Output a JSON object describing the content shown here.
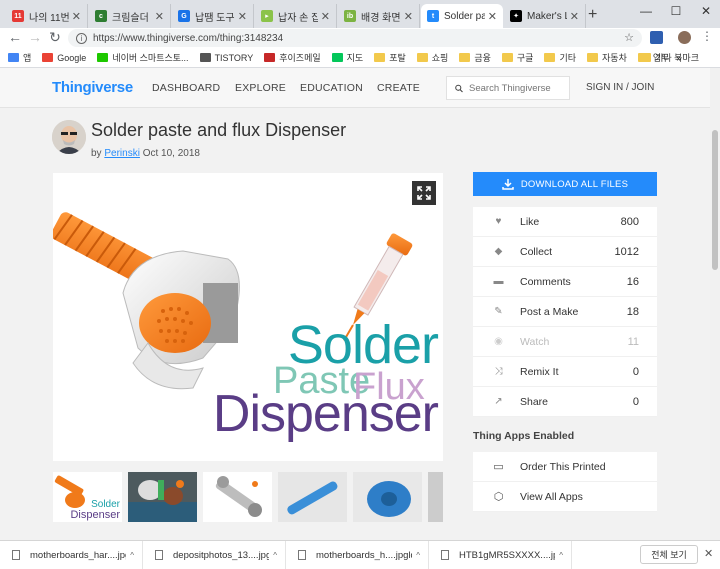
{
  "browser": {
    "tabs": [
      {
        "title": "나의 11번가",
        "color": "#e53935",
        "fav": "11"
      },
      {
        "title": "크림슬더",
        "color": "#2e7d32",
        "fav": "c"
      },
      {
        "title": "납땜 도구 -",
        "color": "#1a73e8",
        "fav": "G"
      },
      {
        "title": "납자 손 집",
        "color": "#8bc34a",
        "fav": "▸"
      },
      {
        "title": "배경 화면",
        "color": "#7cb342",
        "fav": "ib"
      },
      {
        "title": "Solder paste",
        "color": "#248bfb",
        "fav": "t"
      },
      {
        "title": "Maker's LAB",
        "color": "#000000",
        "fav": "✦"
      }
    ],
    "active_tab_index": 5,
    "new_tab": "+",
    "url": "https://www.thingiverse.com/thing:3148234",
    "bookmarks": [
      {
        "label": "앱",
        "type": "apps"
      },
      {
        "label": "Google",
        "type": "google"
      },
      {
        "label": "네이버 스마트스토...",
        "type": "naver"
      },
      {
        "label": "TISTORY",
        "type": "tistory"
      },
      {
        "label": "후이즈메일",
        "type": "whois"
      },
      {
        "label": "지도",
        "type": "map"
      },
      {
        "label": "포탈",
        "type": "folder"
      },
      {
        "label": "쇼핑",
        "type": "folder"
      },
      {
        "label": "금융",
        "type": "folder"
      },
      {
        "label": "구글",
        "type": "folder"
      },
      {
        "label": "기타",
        "type": "folder"
      },
      {
        "label": "자동차",
        "type": "folder"
      },
      {
        "label": "업무",
        "type": "folder"
      }
    ],
    "bookmarks_more": "»",
    "other_bookmarks": "기타 북마크"
  },
  "site": {
    "logo": "Thingiverse",
    "nav": [
      "DASHBOARD",
      "EXPLORE",
      "EDUCATION",
      "CREATE"
    ],
    "search_placeholder": "Search Thingiverse",
    "signin": "SIGN IN / JOIN"
  },
  "thing": {
    "title": "Solder paste and flux Dispenser",
    "by": "by",
    "author": "Perinski",
    "date": "Oct 10, 2018",
    "hero_text": {
      "line1": "Solder",
      "line2a": "Paste",
      "line2b": "Flux",
      "line3": "Dispenser"
    },
    "thumb_texts": [
      "Solder",
      "Dispenser"
    ],
    "download_label": "DOWNLOAD ALL FILES",
    "stats": [
      {
        "icon": "heart-icon",
        "glyph": "♥",
        "label": "Like",
        "value": "800",
        "enabled": true
      },
      {
        "icon": "collect-icon",
        "glyph": "◆",
        "label": "Collect",
        "value": "1012",
        "enabled": true
      },
      {
        "icon": "comment-icon",
        "glyph": "▬",
        "label": "Comments",
        "value": "16",
        "enabled": true
      },
      {
        "icon": "make-icon",
        "glyph": "✎",
        "label": "Post a Make",
        "value": "18",
        "enabled": true
      },
      {
        "icon": "eye-icon",
        "glyph": "◉",
        "label": "Watch",
        "value": "11",
        "enabled": false
      },
      {
        "icon": "remix-icon",
        "glyph": "⤨",
        "label": "Remix It",
        "value": "0",
        "enabled": true
      },
      {
        "icon": "share-icon",
        "glyph": "↗",
        "label": "Share",
        "value": "0",
        "enabled": true
      }
    ],
    "apps_title": "Thing Apps Enabled",
    "apps": [
      {
        "icon": "printer-icon",
        "glyph": "▭",
        "label": "Order This Printed"
      },
      {
        "icon": "cube-icon",
        "glyph": "⬡",
        "label": "View All Apps"
      }
    ]
  },
  "downloads": {
    "items": [
      "motherboards_har....jpg",
      "depositphotos_13....jpg",
      "motherboards_h....jpgld",
      "HTB1gMR5SXXXX....jpg"
    ],
    "show_all": "전체 보기",
    "close": "✕"
  },
  "colors": {
    "accent": "#248bfb",
    "orange": "#f07a1a"
  }
}
